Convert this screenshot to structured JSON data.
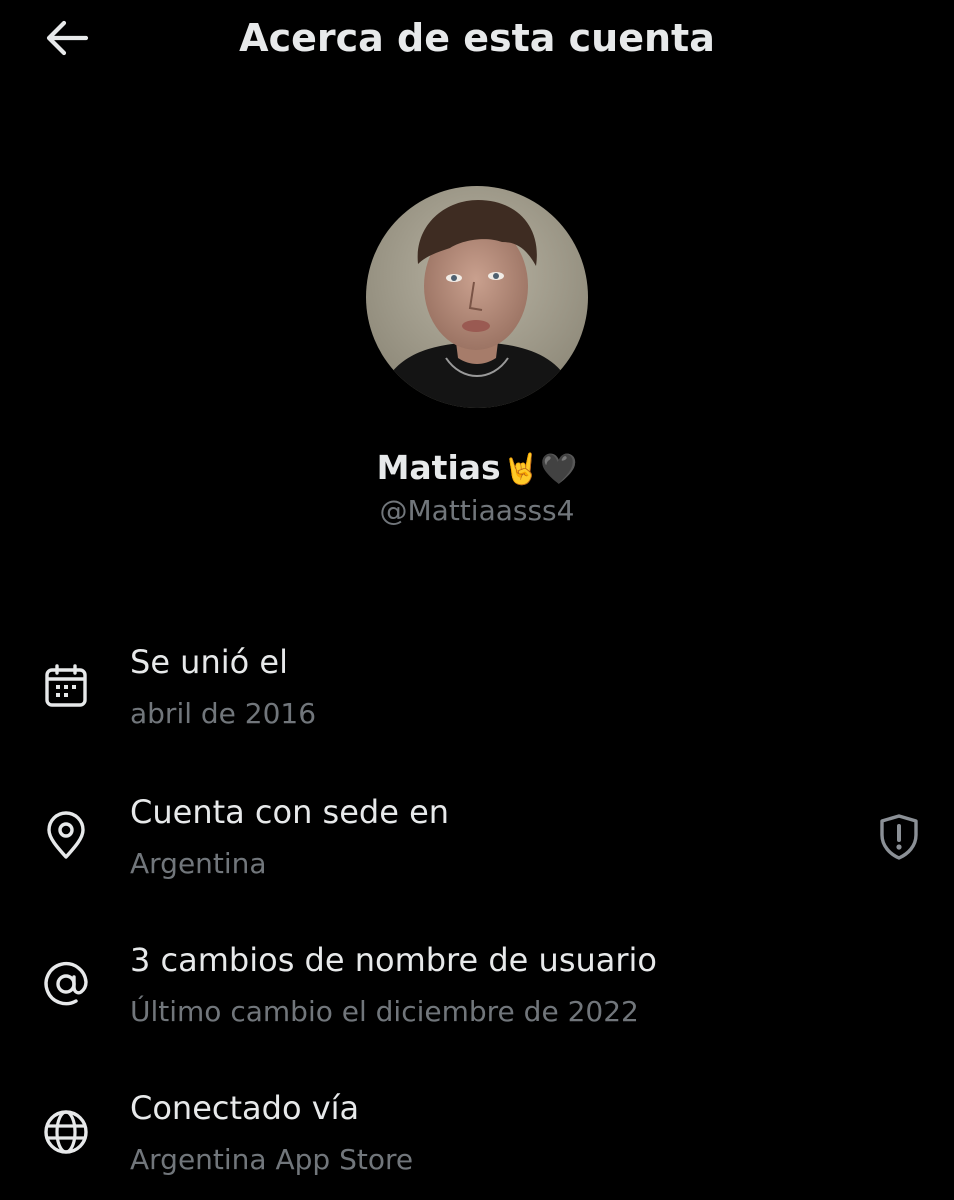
{
  "header": {
    "title": "Acerca de esta cuenta",
    "back_icon": "arrow-left-icon"
  },
  "profile": {
    "display_name": "Matias",
    "name_emojis": "🤘🖤",
    "handle": "@Mattiaasss4"
  },
  "rows": [
    {
      "icon": "calendar-icon",
      "title": "Se unió el",
      "subtitle": "abril de 2016"
    },
    {
      "icon": "location-pin-icon",
      "title": "Cuenta con sede en",
      "subtitle": "Argentina",
      "trailing_icon": "shield-alert-icon"
    },
    {
      "icon": "at-sign-icon",
      "title": "3 cambios de nombre de usuario",
      "subtitle": "Último cambio el diciembre de 2022"
    },
    {
      "icon": "globe-icon",
      "title": "Conectado vía",
      "subtitle": "Argentina App Store"
    }
  ],
  "colors": {
    "background": "#000000",
    "primary_text": "#e7e9ea",
    "secondary_text": "#71767b"
  }
}
